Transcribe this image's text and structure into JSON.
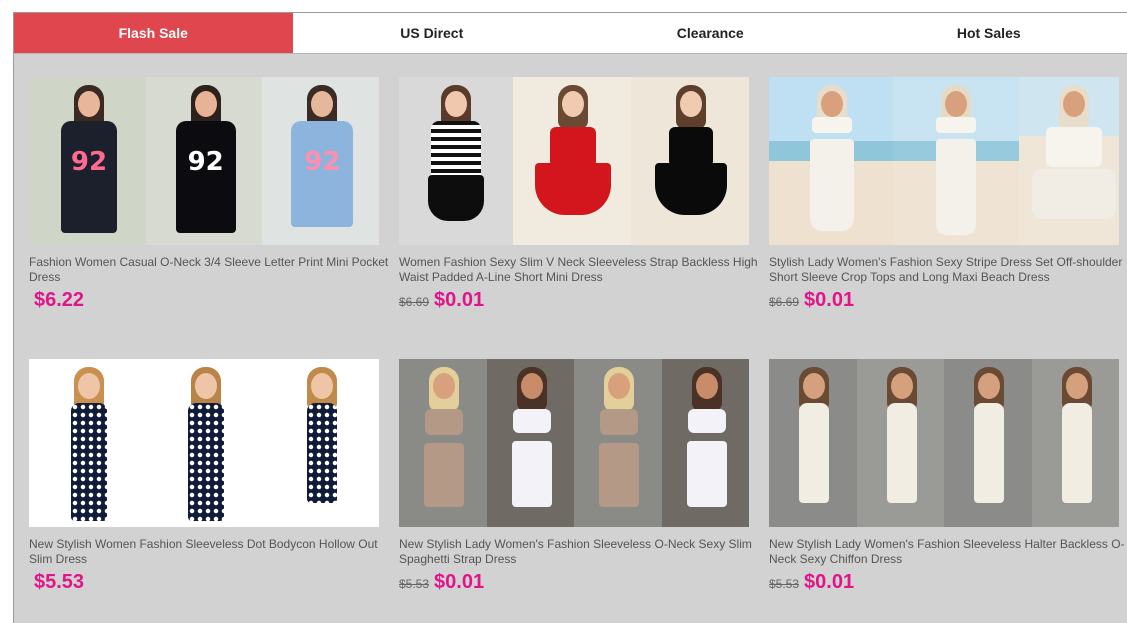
{
  "tabs": [
    {
      "label": "Flash Sale",
      "active": true
    },
    {
      "label": "US Direct",
      "active": false
    },
    {
      "label": "Clearance",
      "active": false
    },
    {
      "label": "Hot Sales",
      "active": false
    }
  ],
  "products": [
    {
      "title": "Fashion Women Casual O-Neck 3/4 Sleeve Letter Print Mini Pocket Dress",
      "old_price": "",
      "price": "$6.22"
    },
    {
      "title": "Women Fashion Sexy Slim V Neck Sleeveless Strap Backless High Waist Padded A-Line Short Mini Dress",
      "old_price": "$6.69",
      "price": "$0.01"
    },
    {
      "title": "Stylish Lady Women's Fashion Sexy Stripe Dress Set Off-shoulder Short Sleeve Crop Tops and Long Maxi Beach Dress",
      "old_price": "$6.69",
      "price": "$0.01"
    },
    {
      "title": "New Stylish Women Fashion Sleeveless Dot Bodycon Hollow Out Slim Dress",
      "old_price": "",
      "price": "$5.53"
    },
    {
      "title": "New Stylish Lady Women's Fashion Sleeveless O-Neck Sexy Slim Spaghetti Strap Dress",
      "old_price": "$5.53",
      "price": "$0.01"
    },
    {
      "title": "New Stylish Lady Women's Fashion Sleeveless Halter Backless O-Neck Sexy Chiffon Dress",
      "old_price": "$5.53",
      "price": "$0.01"
    }
  ],
  "print_text": {
    "number": "92"
  },
  "colors": {
    "active_tab": "#e0464e",
    "price": "#e0158b",
    "background": "#d2d2d2"
  }
}
